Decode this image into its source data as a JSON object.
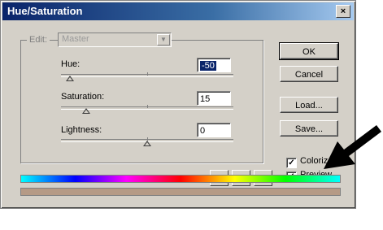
{
  "window": {
    "title": "Hue/Saturation",
    "close": "×"
  },
  "edit": {
    "label": "Edit:",
    "selected": "Master"
  },
  "hue": {
    "label": "Hue:",
    "value": "-50"
  },
  "saturation": {
    "label": "Saturation:",
    "value": "15"
  },
  "lightness": {
    "label": "Lightness:",
    "value": "0"
  },
  "buttons": {
    "ok": "OK",
    "cancel": "Cancel",
    "load": "Load...",
    "save": "Save..."
  },
  "options": {
    "colorize": "Colorize",
    "preview": "Preview",
    "check": "✓"
  },
  "icons": [
    "eyedropper-icon",
    "eyedropper-plus-icon",
    "eyedropper-minus-icon",
    "black-arrow-icon"
  ],
  "colors": {
    "titlebar": "#0a246a",
    "result_bar": "#b59a86",
    "dialog_bg": "#d4d0c8"
  }
}
